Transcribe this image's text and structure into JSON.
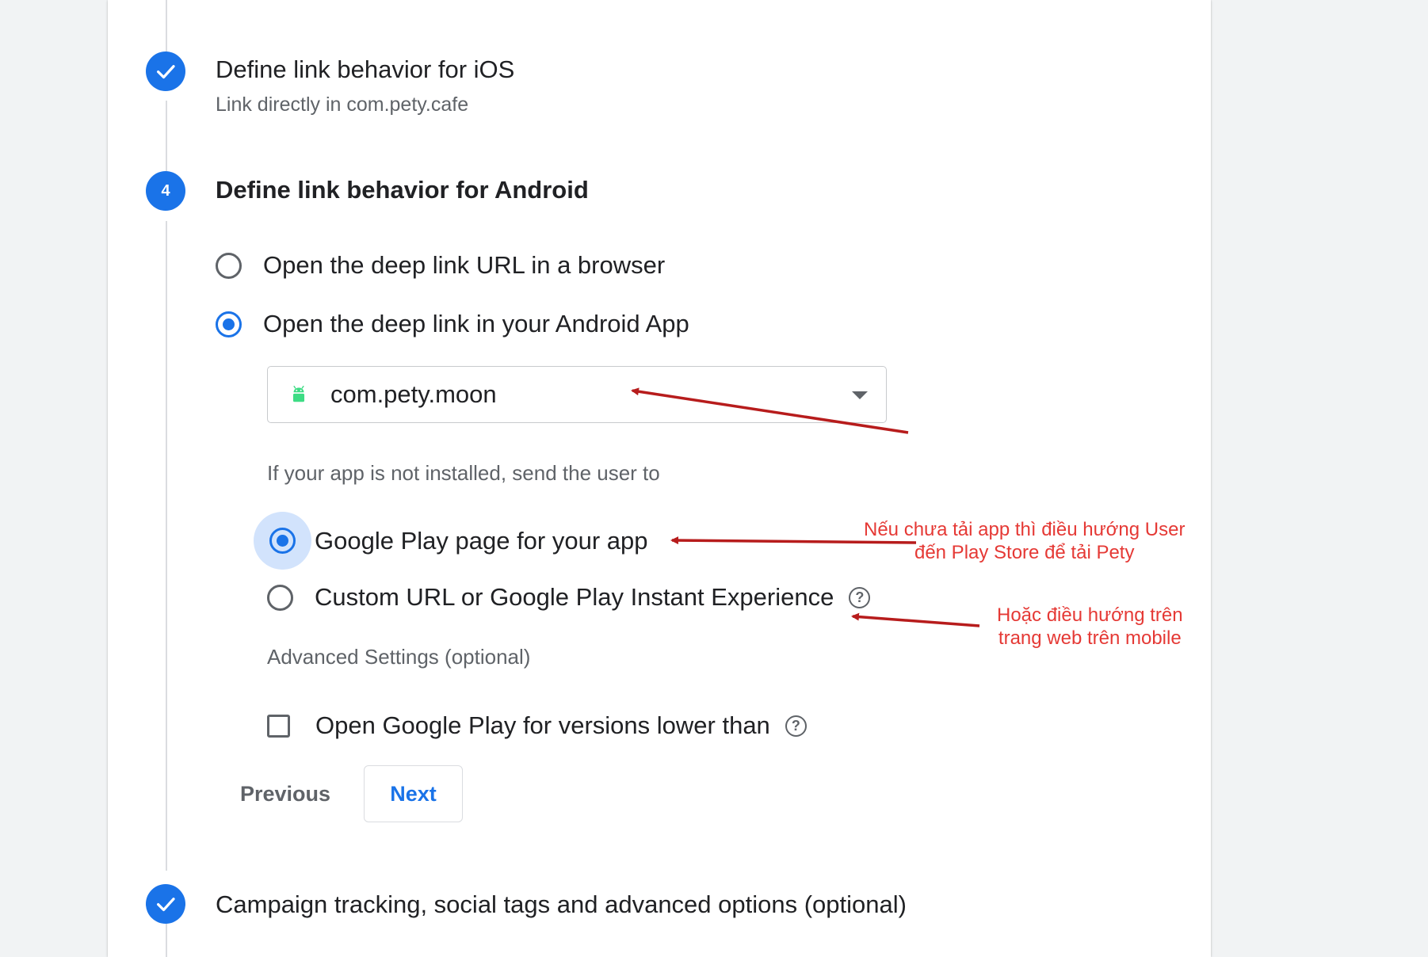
{
  "steps": {
    "ios": {
      "title": "Define link behavior for iOS",
      "subtitle": "Link directly in com.pety.cafe",
      "status_icon": "check-icon"
    },
    "android": {
      "number": "4",
      "title": "Define link behavior for Android",
      "options": {
        "browser": "Open the deep link URL in a browser",
        "app": "Open the deep link in your Android App"
      },
      "selected_option": "app",
      "app_select": {
        "value": "com.pety.moon",
        "icon": "android-icon"
      },
      "fallback_label": "If your app is not installed, send the user to",
      "fallback_options": {
        "google_play": "Google Play page for your app",
        "custom_url": "Custom URL or Google Play Instant Experience"
      },
      "selected_fallback": "google_play",
      "advanced_label": "Advanced Settings (optional)",
      "min_version_checkbox": {
        "label": "Open Google Play for versions lower than",
        "checked": false
      },
      "buttons": {
        "previous": "Previous",
        "next": "Next"
      }
    },
    "campaign": {
      "title": "Campaign tracking, social tags and advanced options (optional)",
      "status_icon": "check-icon"
    }
  },
  "annotations": {
    "google_play_note": [
      "Nếu chưa tải app thì điều hướng User",
      "đến Play Store để tải Pety"
    ],
    "custom_url_note": [
      "Hoặc điều hướng trên",
      "trang web trên mobile"
    ]
  },
  "colors": {
    "accent": "#1a73e8",
    "annotation_text": "#e53935",
    "annotation_arrow": "#b71c1c",
    "android_green": "#3ddc84"
  }
}
